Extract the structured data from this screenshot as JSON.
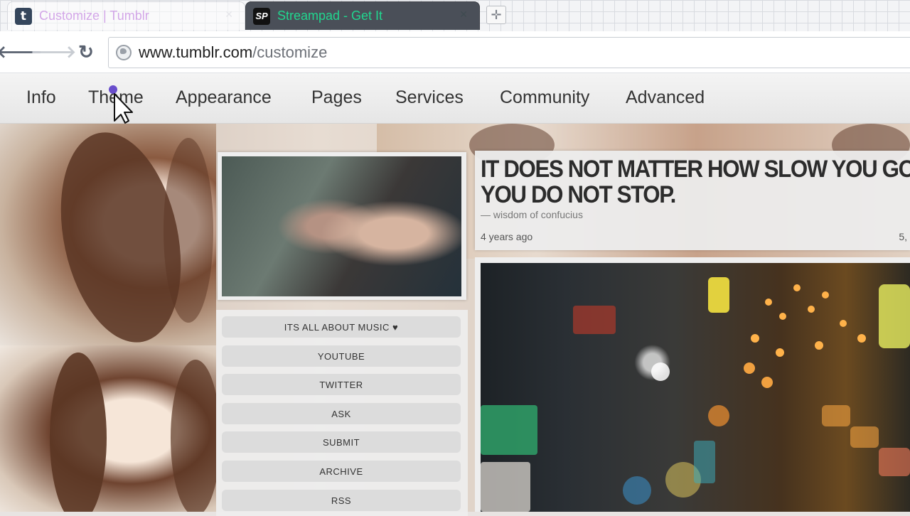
{
  "browser": {
    "tabs": [
      {
        "title": "Customize | Tumblr",
        "favicon": "tumblr-favicon",
        "active": false
      },
      {
        "title": "Streampad - Get It",
        "favicon": "streampad-favicon",
        "active": true
      }
    ],
    "url_host": "www.tumblr.com",
    "url_path": "/customize"
  },
  "customize_nav": {
    "items": [
      "Info",
      "Theme",
      "Appearance",
      "Pages",
      "Services",
      "Community",
      "Advanced"
    ]
  },
  "sidebar_menu": {
    "items": [
      "ITS ALL ABOUT MUSIC ♥",
      "YOUTUBE",
      "TWITTER",
      "ASK",
      "SUBMIT",
      "ARCHIVE",
      "RSS"
    ]
  },
  "quote_post": {
    "line1": "IT DOES NOT MATTER HOW SLOW YOU GO SO LONG AS",
    "line2": "YOU DO NOT STOP.",
    "source": "— wisdom of confucius",
    "timestamp": "4 years ago",
    "notes": "5,"
  },
  "colors": {
    "tumblr_brand": "#35465c",
    "streampad_title": "#21d68f",
    "inactive_tab_title": "#d3a7e8"
  }
}
